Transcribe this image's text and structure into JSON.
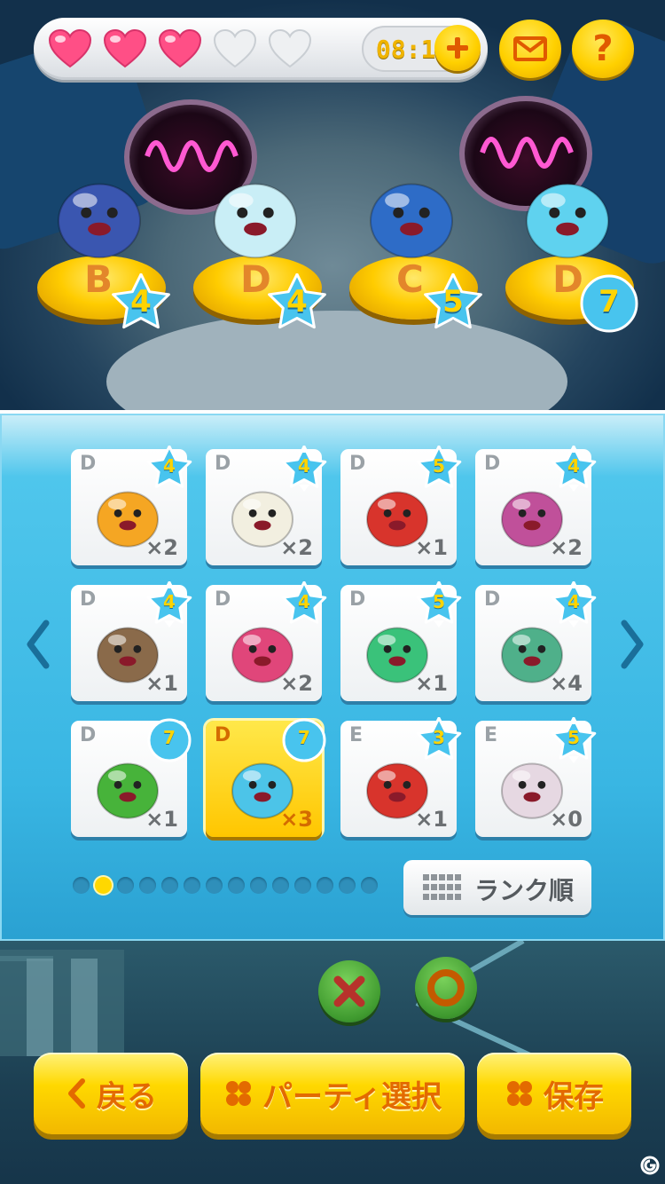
{
  "hud": {
    "hearts": [
      {
        "state": "full"
      },
      {
        "state": "full"
      },
      {
        "state": "full"
      },
      {
        "state": "empty"
      },
      {
        "state": "empty"
      }
    ],
    "timer": "08:10",
    "plus_icon": "plus-icon",
    "mail_icon": "mail-icon",
    "help_icon": "question-icon"
  },
  "party": [
    {
      "rank": "B",
      "stars": "4",
      "badge": "star"
    },
    {
      "rank": "D",
      "stars": "4",
      "badge": "star"
    },
    {
      "rank": "C",
      "stars": "5",
      "badge": "star"
    },
    {
      "rank": "D",
      "stars": "7",
      "badge": "circle"
    }
  ],
  "collection": [
    {
      "rank": "D",
      "level": "4",
      "count": "×2",
      "badge": "star",
      "color": "#f5a623"
    },
    {
      "rank": "D",
      "level": "4",
      "count": "×2",
      "badge": "star-arrows",
      "color": "#f2efe0"
    },
    {
      "rank": "D",
      "level": "5",
      "count": "×1",
      "badge": "star",
      "color": "#d8342c"
    },
    {
      "rank": "D",
      "level": "4",
      "count": "×2",
      "badge": "star-arrows",
      "color": "#c0509a"
    },
    {
      "rank": "D",
      "level": "4",
      "count": "×1",
      "badge": "star-arrows",
      "color": "#8a6a4a"
    },
    {
      "rank": "D",
      "level": "4",
      "count": "×2",
      "badge": "star",
      "color": "#e0467a"
    },
    {
      "rank": "D",
      "level": "5",
      "count": "×1",
      "badge": "star-arrows",
      "color": "#3ac27a"
    },
    {
      "rank": "D",
      "level": "4",
      "count": "×4",
      "badge": "star-arrows",
      "color": "#4fb08a"
    },
    {
      "rank": "D",
      "level": "7",
      "count": "×1",
      "badge": "circle",
      "color": "#47b33a"
    },
    {
      "rank": "D",
      "level": "7",
      "count": "×3",
      "badge": "circle",
      "color": "#4cc4e8",
      "selected": true
    },
    {
      "rank": "E",
      "level": "3",
      "count": "×1",
      "badge": "star",
      "color": "#d8342c"
    },
    {
      "rank": "E",
      "level": "5",
      "count": "×0",
      "badge": "star-arrows",
      "color": "#e6d8e2"
    }
  ],
  "pager": {
    "total": 14,
    "active": 2
  },
  "sort_button": {
    "label": "ランク順",
    "icon": "grid-icon"
  },
  "actions": {
    "cancel_icon": "cross-icon",
    "confirm_icon": "circle-icon"
  },
  "footer": {
    "back": "戻る",
    "party_select": "パーティ選択",
    "save": "保存"
  },
  "colors": {
    "panel": "#39b6e3",
    "gold": "#ffd800",
    "orange_text": "#e36a00"
  }
}
